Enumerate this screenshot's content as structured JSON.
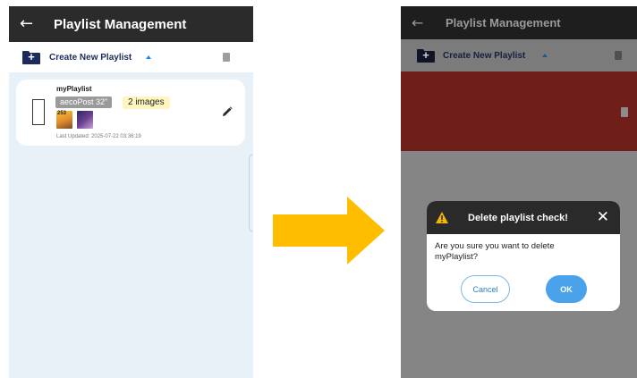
{
  "before": {
    "header": {
      "title": "Playlist Management"
    },
    "toolbar": {
      "create_label": "Create New Playlist"
    },
    "playlist": {
      "name": "myPlaylist",
      "tag": "aecoPost 32\"",
      "image_count": "2 images",
      "thumb1_text": "253",
      "last_updated": "Last Updated: 2025-07-22 03:36:19"
    }
  },
  "after": {
    "header": {
      "title": "Playlist Management"
    },
    "toolbar": {
      "create_label": "Create New Playlist"
    },
    "dialog": {
      "title": "Delete playlist check!",
      "message": "Are you sure you want to delete myPlaylist?",
      "cancel_label": "Cancel",
      "ok_label": "OK"
    }
  },
  "colors": {
    "appbar": "#2b2b2b",
    "accent": "#1e88e5",
    "delete_highlight": "#6f1e1a",
    "arrow": "#ffc107",
    "ok_button": "#4aa3ea"
  }
}
